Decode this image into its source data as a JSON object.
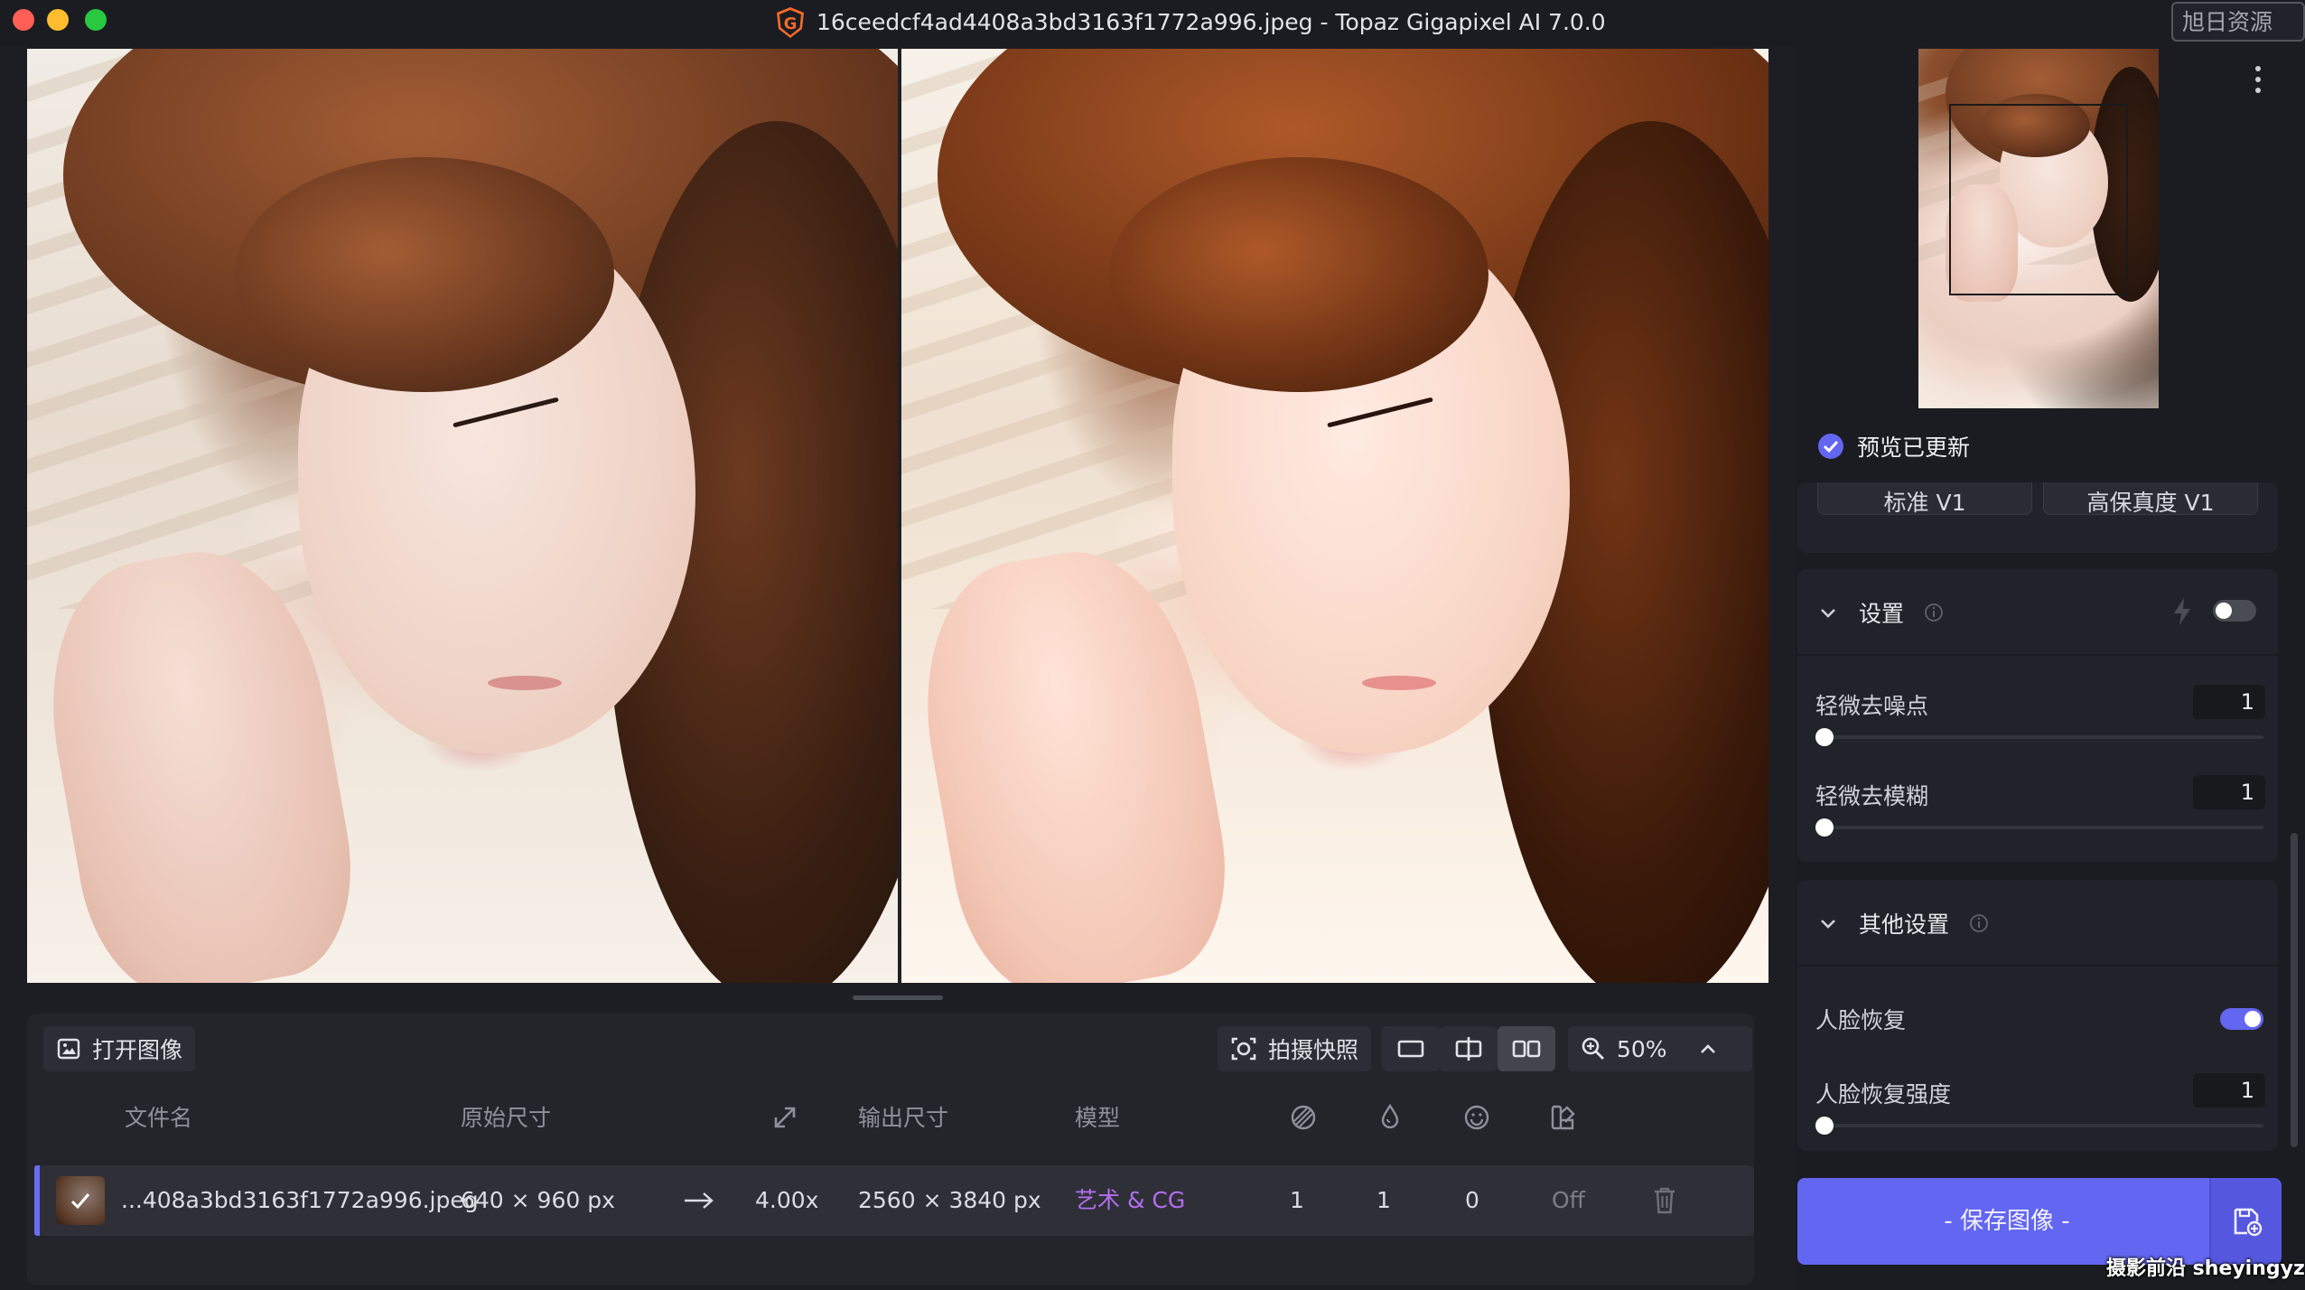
{
  "window": {
    "title": "16ceedcf4ad4408a3bd3163f1772a996.jpeg - Topaz Gigapixel AI 7.0.0",
    "watermark_top": "旭日资源网",
    "watermark_bottom": "摄影前沿 sheyingyz.com"
  },
  "toolbar": {
    "open_image": "打开图像",
    "snapshot": "拍摄快照",
    "zoom": "50%"
  },
  "table": {
    "headers": {
      "filename": "文件名",
      "original_size": "原始尺寸",
      "output_size": "输出尺寸",
      "model": "模型"
    },
    "row": {
      "filename": "...408a3bd3163f1772a996.jpeg",
      "original_size": "640 × 960 px",
      "scale": "4.00x",
      "output_size": "2560 × 3840 px",
      "model": "艺术 & CG",
      "denoise": "1",
      "deblur": "1",
      "face": "0",
      "extra": "Off"
    }
  },
  "right_panel": {
    "preview_status": "预览已更新",
    "model_tabs": [
      "标准 V1",
      "高保真度 V1"
    ],
    "settings": {
      "title": "设置",
      "denoise_label": "轻微去噪点",
      "denoise_value": "1",
      "deblur_label": "轻微去模糊",
      "deblur_value": "1"
    },
    "other_settings": {
      "title": "其他设置",
      "face_recovery_label": "人脸恢复",
      "face_strength_label": "人脸恢复强度",
      "face_strength_value": "1"
    },
    "save_button": "- 保存图像 -"
  },
  "colors": {
    "accent": "#6366f1",
    "model_text": "#b36ef0",
    "background": "#1d1e23"
  }
}
